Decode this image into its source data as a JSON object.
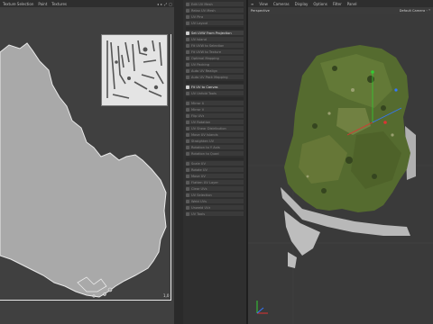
{
  "texture_view": {
    "menu": [
      "Texture Selection",
      "Paint",
      "Textures"
    ],
    "toolicons": [
      "◂",
      "▸",
      "⤢",
      "▢"
    ],
    "coordinate": "1,0"
  },
  "commands": {
    "groups": [
      {
        "items": [
          "Edit UV Mesh",
          "Relax UV Mesh",
          "UV Pins",
          "UV Layout"
        ]
      },
      {
        "items": [
          "Set UVW From Projection",
          "UV Island",
          "Fit UVW to Selection",
          "Fit UVW to Texture",
          "Optimal Mapping",
          "UV Packing",
          "Auto UV Realign",
          "Auto UV Pack Mapping"
        ]
      },
      {
        "items": [
          "Fit UV to Canvas",
          "UV Unfold Tools"
        ]
      },
      {
        "items": [
          "Mirror U",
          "Mirror V",
          "Flip UVs",
          "UV Rotation",
          "UV Shear Distribution",
          "Move UV Islands",
          "Straighten UV",
          "Rotation to Y Axis",
          "Rotation to Quad"
        ]
      },
      {
        "items": [
          "Scale UV",
          "Rotate UV",
          "Move UV",
          "Flatten UV Layer",
          "Clear UVs",
          "UV Selection",
          "Weld UVs",
          "Unweld UVs",
          "UV Tools"
        ]
      }
    ],
    "highlighted": [
      "Set UVW From Projection",
      "Fit UV to Canvas"
    ]
  },
  "viewport": {
    "menu": [
      "≡",
      "View",
      "Cameras",
      "Display",
      "Options",
      "Filter",
      "Panel"
    ],
    "mode": "Perspective",
    "camera": "Default Camera ◦ ⁰"
  },
  "colors": {
    "accent": "#e0e0e0",
    "uv_land": "#a8a8a8",
    "terrain_green": "#556b2f",
    "axis_x": "#d33",
    "axis_y": "#3c3",
    "axis_z": "#37f"
  }
}
